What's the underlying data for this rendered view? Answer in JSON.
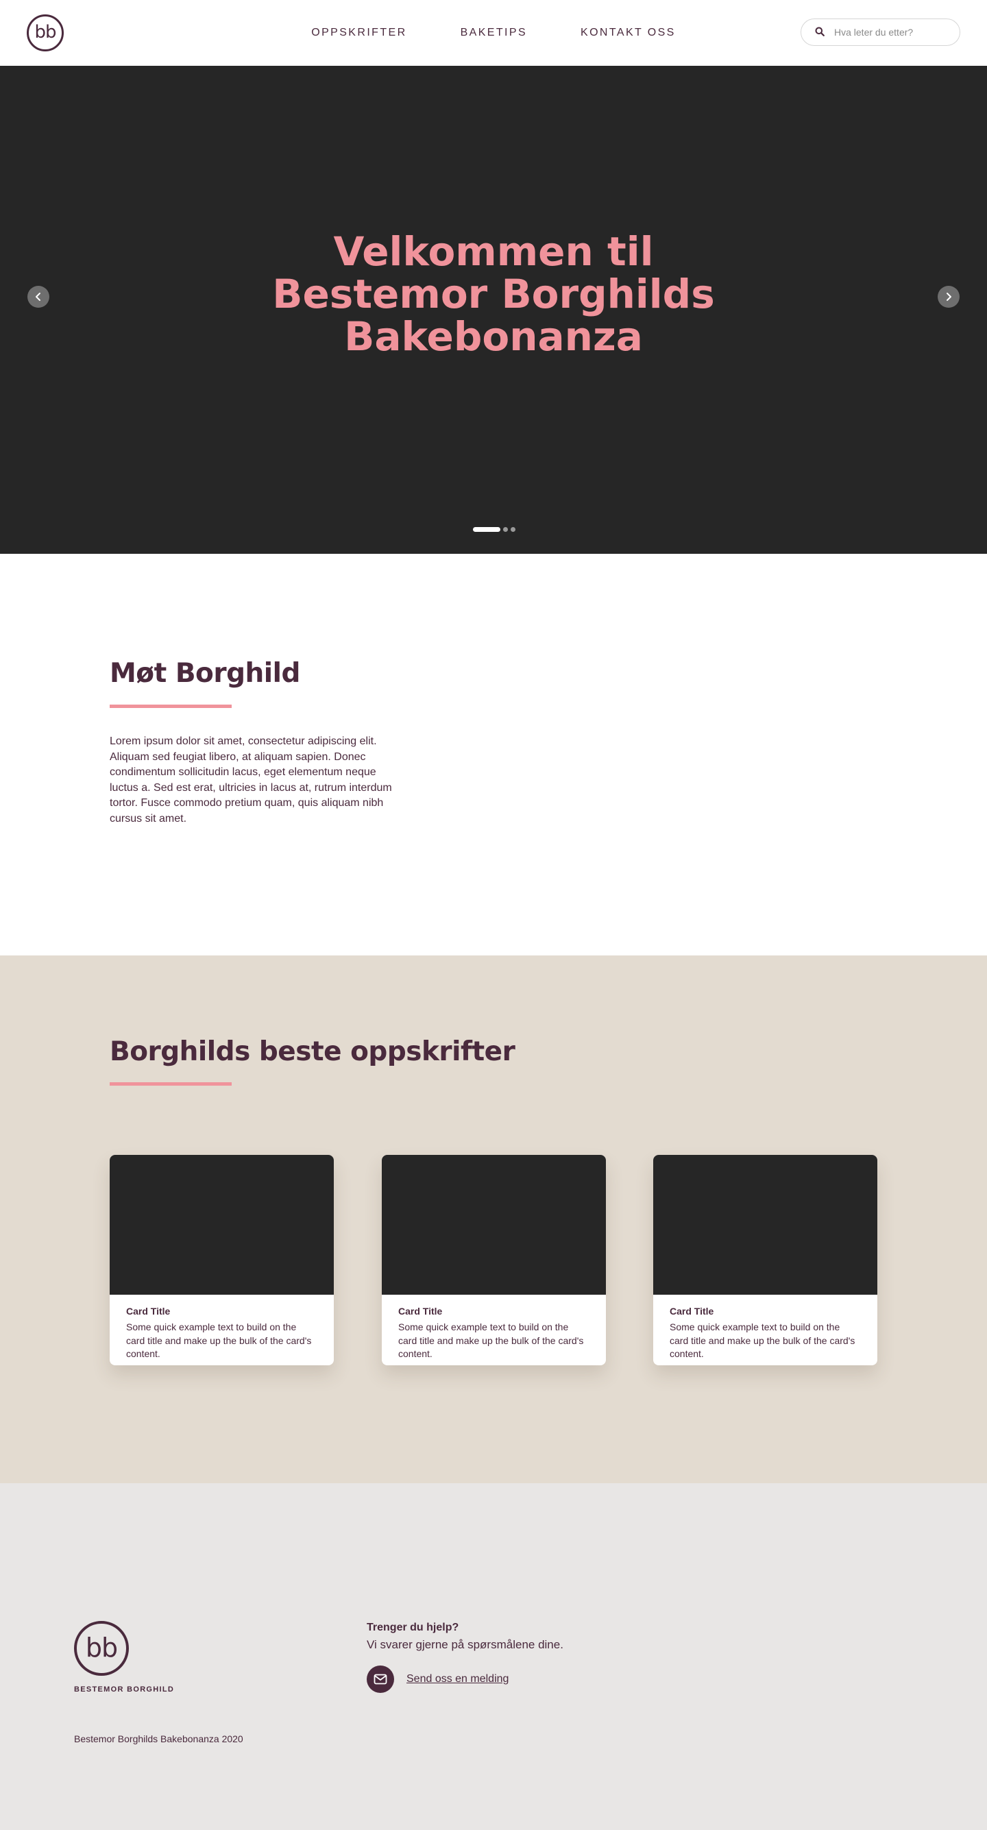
{
  "header": {
    "logo_text": "bb",
    "nav": [
      {
        "label": "OPPSKRIFTER"
      },
      {
        "label": "BAKETIPS"
      },
      {
        "label": "KONTAKT OSS"
      }
    ],
    "search": {
      "placeholder": "Hva leter du etter?",
      "value": ""
    }
  },
  "hero": {
    "title_lines": [
      "Velkommen til",
      "Bestemor Borghilds",
      "Bakebonanza"
    ],
    "slides_total": 3,
    "active_slide": 1
  },
  "about": {
    "title": "Møt Borghild",
    "text": "Lorem ipsum dolor sit amet, consectetur adipiscing elit. Aliquam sed feugiat libero, at aliquam sapien. Donec condimentum sollicitudin lacus, eget elementum neque luctus a. Sed est erat, ultricies in lacus at, rutrum interdum tortor. Fusce commodo pretium quam, quis aliquam nibh cursus sit amet."
  },
  "recipes": {
    "title": "Borghilds beste oppskrifter",
    "cards": [
      {
        "title": "Card Title",
        "text": "Some quick example text to build on the card title and make up the bulk of the card's content."
      },
      {
        "title": "Card Title",
        "text": "Some quick example text to build on the card title and make up the bulk of the card's content."
      },
      {
        "title": "Card Title",
        "text": "Some quick example text to build on the card title and make up the bulk of the card's content."
      }
    ]
  },
  "footer": {
    "logo_text": "bb",
    "brand_name": "BESTEMOR BORGHILD",
    "help_title": "Trenger du hjelp?",
    "help_text": "Vi svarer gjerne på spørsmålene dine.",
    "contact_label": "Send oss en melding",
    "copyright": "Bestemor Borghilds Bakebonanza 2020"
  },
  "colors": {
    "primary": "#4a2a3d",
    "accent_pink": "#f0939b",
    "hero_bg": "#262626",
    "recipes_bg": "#e3dbd0",
    "footer_bg": "#e8e6e5"
  },
  "icons": {
    "search": "search-icon",
    "prev": "chevron-left-icon",
    "next": "chevron-right-icon",
    "mail": "envelope-icon"
  }
}
